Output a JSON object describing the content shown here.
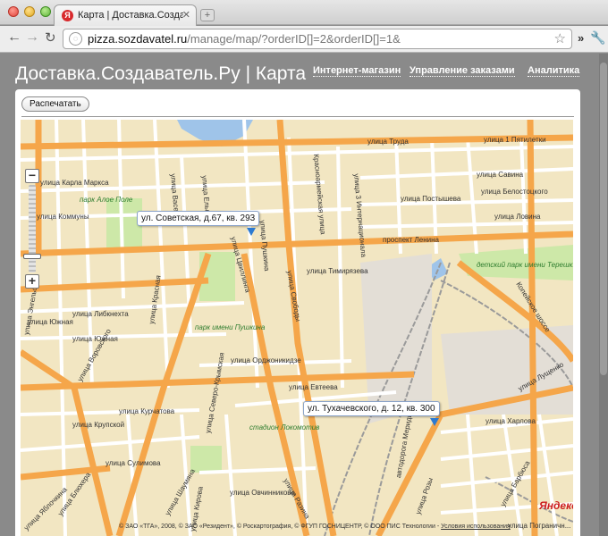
{
  "browser": {
    "tab_title": "Карта | Доставка.Создавател",
    "tab_favicon": "yandex-b",
    "url_host": "pizza.sozdavatel.ru",
    "url_path": "/manage/map/?orderID[]=2&orderID[]=1&",
    "more_label": "»"
  },
  "page": {
    "title": "Доставка.Создаватель.Ру | Карта",
    "nav": [
      {
        "label": "Интернет-магазин"
      },
      {
        "label": "Управление заказами"
      },
      {
        "label": "Аналитика"
      }
    ],
    "print_button": "Распечатать"
  },
  "map": {
    "markers": [
      {
        "label": "ул. Советская, д.67, кв. 293"
      },
      {
        "label": "ул. Тухачевского, д. 12, кв. 300"
      }
    ],
    "streets": [
      "улица Труда",
      "улица 1 Пятилетки",
      "улица Карла Маркса",
      "улица Коммуны",
      "улица Савина",
      "улица Белостоцкого",
      "улица Постышева",
      "улица Ловина",
      "проспект Ленина",
      "улица Тимирязева",
      "улица Либкнехта",
      "улица Южная",
      "улица Орджоникидзе",
      "улица Евтеева",
      "улица Харлова",
      "улица Курчатова",
      "улица Крупской",
      "улица Сулимова",
      "улица Овчинникова",
      "улица Красная",
      "улица Свободы",
      "улица Пушкина",
      "улица Энгельса",
      "улица Воровского",
      "улица Пограничн...",
      "улица Лущенко",
      "улица Разина",
      "улица Блюхера",
      "улица Яблочкина",
      "улица 3 Интернационала",
      "улица Розы",
      "Копейское шоссе",
      "улица Барбюса",
      "улица Васенко",
      "улица Елькина",
      "улица Цвиллинга",
      "Красноармейская улица",
      "автодорога Меридиан",
      "улица Южная",
      "улица Шаумяна",
      "улица Кирова",
      "улица Северо-Крымская"
    ],
    "parks": [
      "парк Алое Поле",
      "парк имени Пушкина",
      "детский парк имени Терешк...",
      "стадион Локомотив"
    ],
    "logo": "Яндекс",
    "copyright_text": "© ЗАО «ТГА», 2008, © ЗАО «Резидент», © Роскартография, © ФГУП ГОСНИЦЕНТР, © ООО ПИС Технологии",
    "copyright_link": "Условия использования",
    "zoom_minus": "−",
    "zoom_plus": "+",
    "zoom_level": 0.84
  },
  "colors": {
    "road_major": "#f5a64a",
    "road_minor": "#ffffff",
    "block": "#f2e6c2",
    "park": "#cde8a8",
    "water": "#9fc4e9",
    "rail": "#9a9a9a",
    "industrial": "#e3ded6"
  }
}
